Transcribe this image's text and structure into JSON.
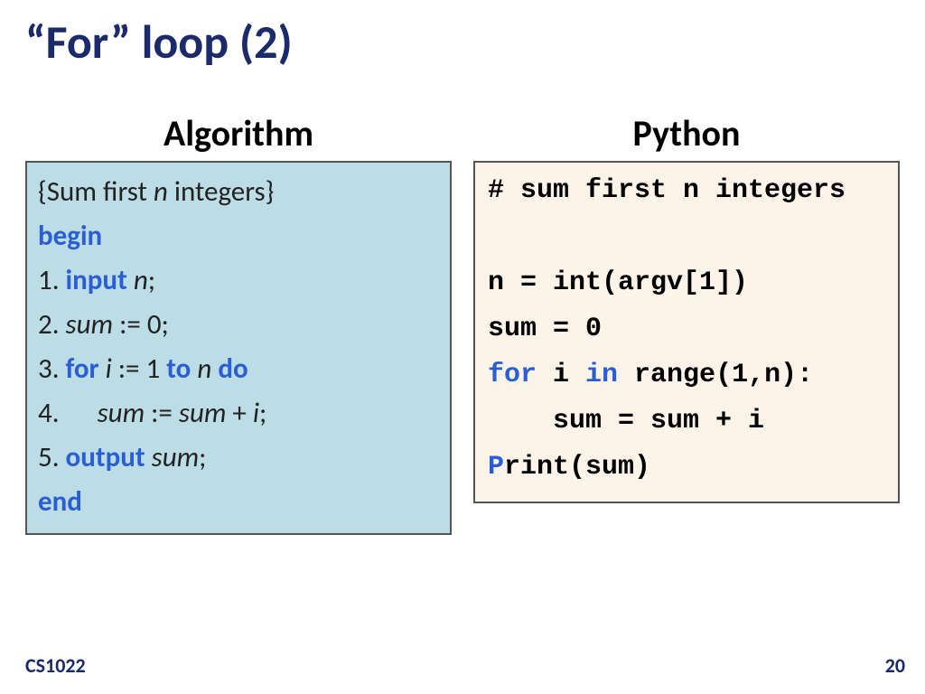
{
  "title": "“For” loop (2)",
  "left": {
    "heading": "Algorithm",
    "l1": " {Sum first ",
    "l1n": "n",
    "l1end": " integers}",
    "begin": "begin",
    "s1a": "1. ",
    "s1kw": "input",
    "s1b": " ",
    "s1n": "n",
    "s1c": ";",
    "s2a": "2. ",
    "s2sum": "sum",
    "s2b": " := 0;",
    "s3a": "3. ",
    "s3for": "for",
    "s3b": " ",
    "s3i": "i",
    "s3c": " := 1 ",
    "s3to": "to",
    "s3d": " ",
    "s3n": "n",
    "s3e": " ",
    "s3do": "do",
    "s4a": "4.      ",
    "s4sum": "sum",
    "s4b": " := ",
    "s4sum2": "sum",
    "s4c": " + ",
    "s4i": "i",
    "s4d": ";",
    "s5a": "5. ",
    "s5kw": "output",
    "s5b": " ",
    "s5sum": "sum",
    "s5c": ";",
    "end": "end"
  },
  "right": {
    "heading": "Python",
    "l1": "# sum first n integers",
    "blank": " ",
    "l2": "n = int(argv[1])",
    "l3": "sum = 0",
    "l4a": "for",
    "l4b": " i ",
    "l4c": "in",
    "l4d": " range(1,n):",
    "l5": "    sum = sum + i",
    "l6a1": "P",
    "l6a2": "rint",
    "l6b": "(sum)"
  },
  "footer": {
    "course": "CS1022",
    "page": "20"
  }
}
